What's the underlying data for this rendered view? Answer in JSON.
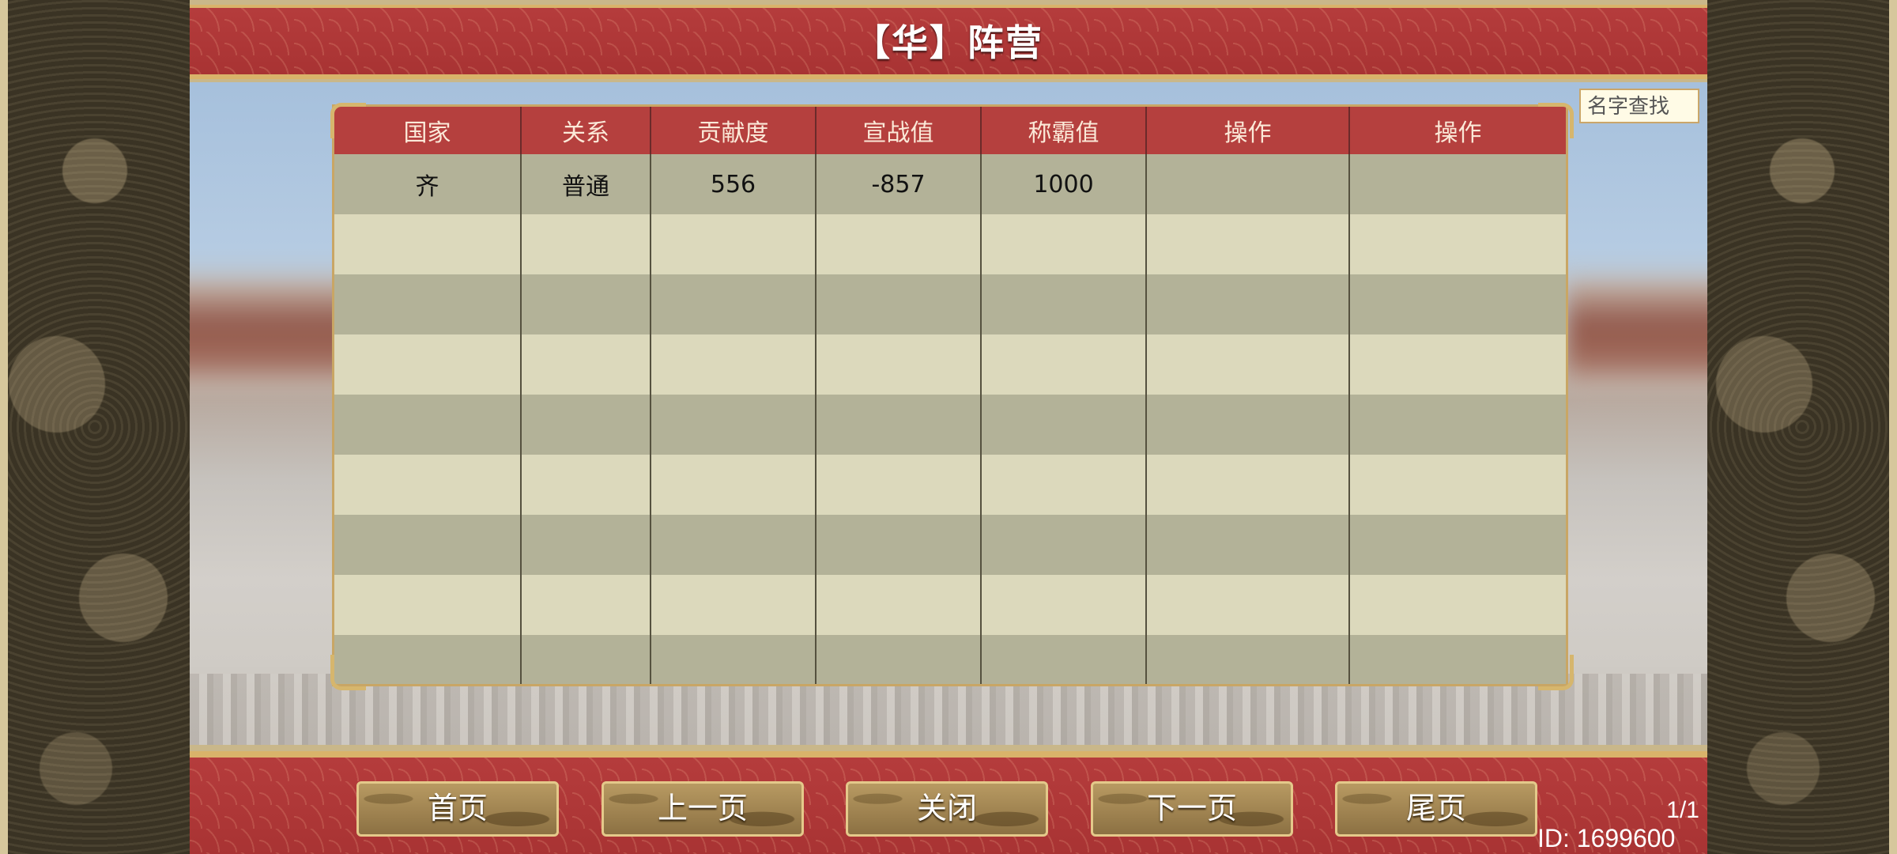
{
  "header": {
    "title": "【华】阵营"
  },
  "search": {
    "placeholder": "名字查找"
  },
  "table": {
    "columns": [
      "国家",
      "关系",
      "贡献度",
      "宣战值",
      "称霸值",
      "操作",
      "操作"
    ],
    "rows": [
      [
        "齐",
        "普通",
        "556",
        "-857",
        "1000",
        "",
        ""
      ],
      [
        "",
        "",
        "",
        "",
        "",
        "",
        ""
      ],
      [
        "",
        "",
        "",
        "",
        "",
        "",
        ""
      ],
      [
        "",
        "",
        "",
        "",
        "",
        "",
        ""
      ],
      [
        "",
        "",
        "",
        "",
        "",
        "",
        ""
      ],
      [
        "",
        "",
        "",
        "",
        "",
        "",
        ""
      ],
      [
        "",
        "",
        "",
        "",
        "",
        "",
        ""
      ],
      [
        "",
        "",
        "",
        "",
        "",
        "",
        ""
      ],
      [
        "",
        "",
        "",
        "",
        "",
        "",
        ""
      ]
    ]
  },
  "footer": {
    "first_label": "首页",
    "prev_label": "上一页",
    "close_label": "关闭",
    "next_label": "下一页",
    "last_label": "尾页",
    "page_indicator": "1/1",
    "user_id": "ID: 1699600"
  },
  "colors": {
    "header_red": "#b5403e",
    "gold_trim": "#d9b36a",
    "row_dark": "#b3b298",
    "row_light": "#dcd9bc"
  },
  "icons": [
    "dragon-ornament-icon",
    "corner-ornament-icon"
  ]
}
